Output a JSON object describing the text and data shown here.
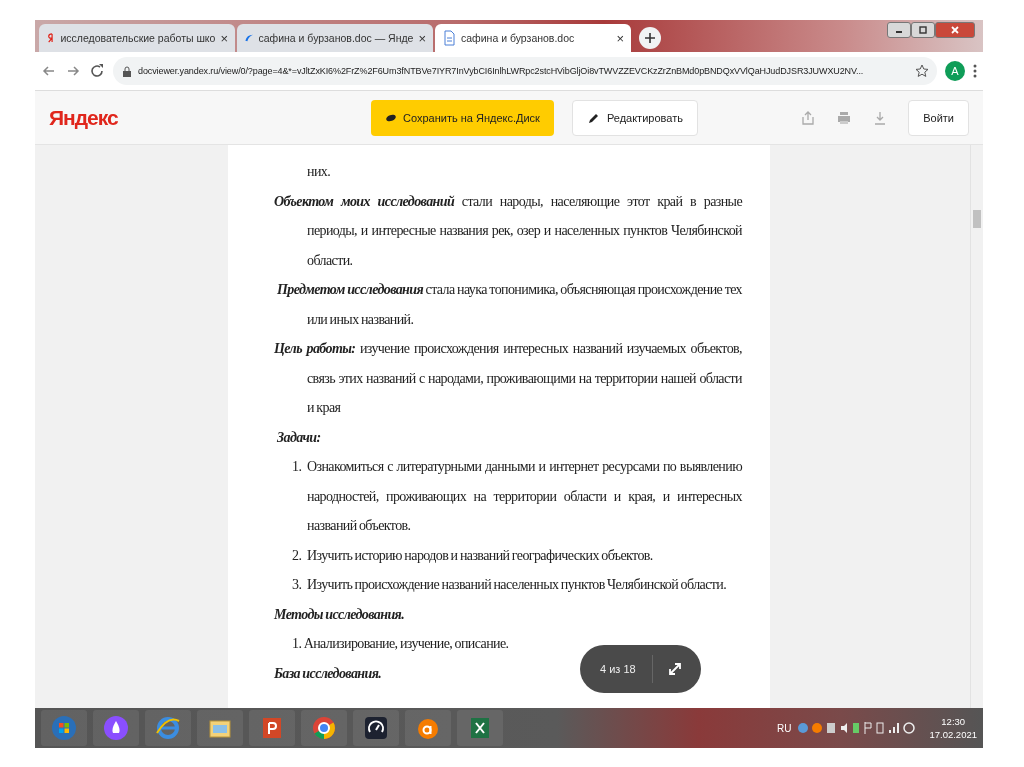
{
  "browser": {
    "tabs": [
      {
        "title": "исследовательские работы шко",
        "close": "×",
        "selected": false
      },
      {
        "title": "сафина и бурзанов.doc — Янде",
        "close": "×",
        "selected": false
      },
      {
        "title": "сафина и бурзанов.doc",
        "close": "×",
        "selected": true
      }
    ],
    "url": "docviewer.yandex.ru/view/0/?page=4&*=vJltZxKI6%2FrZ%2F6Um3fNTBVe7IYR7InVybCI6InlhLWRpc2stcHVibGljOi8vTWVZZEVCKzZrZnBMd0pBNDQxVVlQaHJudDJSR3JUWXU2NV...",
    "avatar": "A"
  },
  "viewer": {
    "logo": "Яндекс",
    "save_button": "Сохранить на Яндекс.Диск",
    "edit_button": "Редактировать",
    "login_button": "Войти"
  },
  "document": {
    "blocks": [
      {
        "kind": "continuation",
        "text": "них."
      },
      {
        "kind": "paragraph",
        "lead": "Объектом моих исследований",
        "text": " стали народы, населяющие этот край в разные периоды,  и интересные названия рек, озер и населенных пунктов Челябинской области."
      },
      {
        "kind": "paragraph",
        "lead": "Предметом исследования",
        "text": " стала наука топонимика, объясняющая происхождение тех или иных названий."
      },
      {
        "kind": "paragraph",
        "lead": "Цель работы:",
        "text": " изучение происхождения интересных названий изучаемых объектов, связь этих названий с народами, проживающими на территории нашей области и края"
      },
      {
        "kind": "heading",
        "text": "Задачи:"
      },
      {
        "kind": "item",
        "number": "1.",
        "text": "Ознакомиться с литературными данными и интернет ресурсами по выявлению народностей, проживающих на территории области и края, и интересных названий объектов."
      },
      {
        "kind": "item",
        "number": "2.",
        "text": "Изучить историю народов и  названий географических объектов."
      },
      {
        "kind": "item",
        "number": "3.",
        "text": "Изучить происхождение названий населенных пунктов Челябинской области."
      },
      {
        "kind": "heading",
        "text": "Методы исследования."
      },
      {
        "kind": "inline_item",
        "text": "1. Анализирование, изучение, описание."
      },
      {
        "kind": "heading",
        "text": "База исследования."
      }
    ],
    "page_indicator": "4 из 18"
  },
  "taskbar": {
    "language": "RU",
    "time": "12:30",
    "date": "17.02.2021"
  }
}
